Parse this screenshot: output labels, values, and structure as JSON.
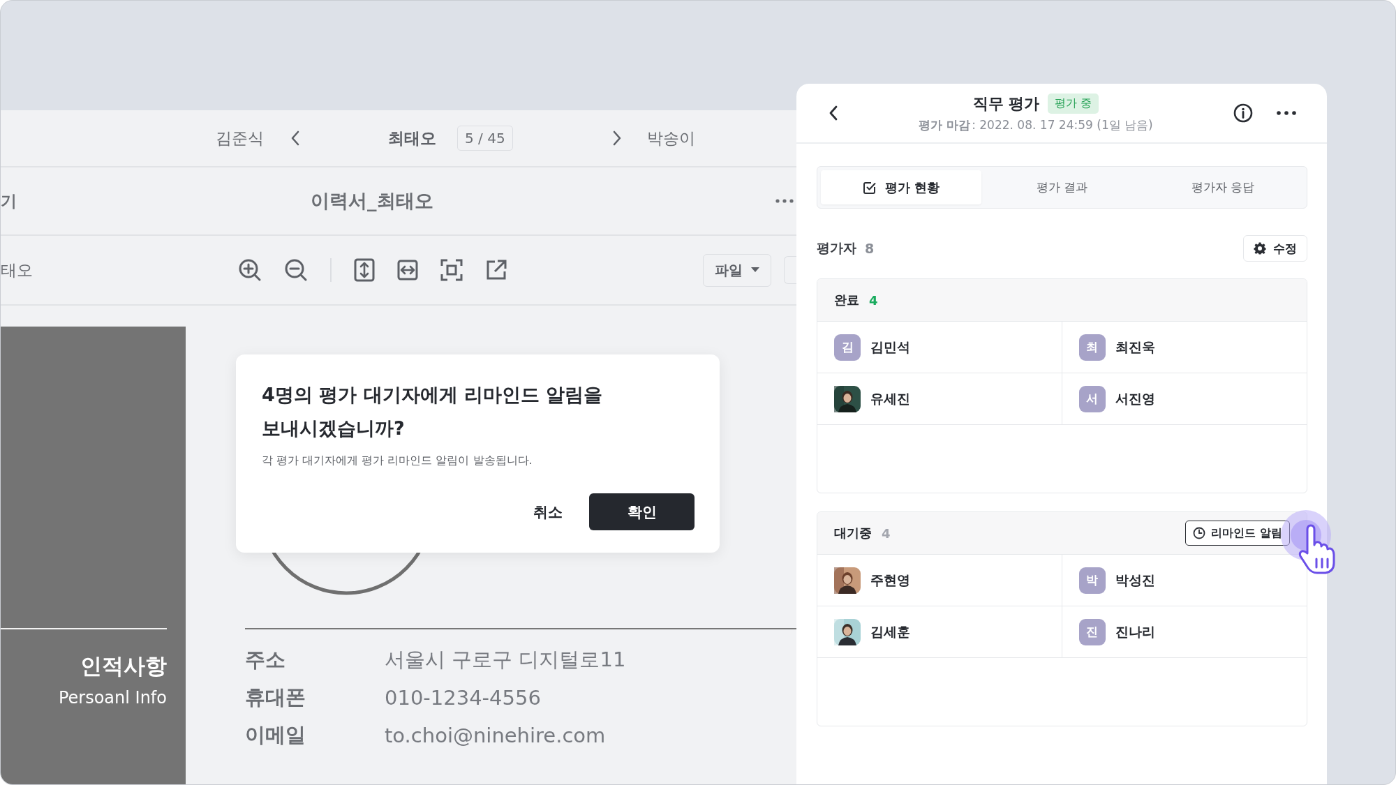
{
  "viewer": {
    "nav": {
      "prev_name": "김준식",
      "current_name": "최태오",
      "position": "5 / 45",
      "next_name": "박송이"
    },
    "title_bar": {
      "left_text": "기",
      "title": "이력서_최태오"
    },
    "toolbar": {
      "left_text": "태오",
      "file_menu": "파일"
    },
    "document": {
      "section_title": "인적사항",
      "section_subtitle": "Persoanl Info",
      "fields": [
        {
          "label": "주소",
          "value": "서울시 구로구 디지털로11"
        },
        {
          "label": "휴대폰",
          "value": "010-1234-4556"
        },
        {
          "label": "이메일",
          "value": "to.choi@ninehire.com"
        }
      ]
    }
  },
  "dialog": {
    "title_lines": [
      "4명의 평가 대기자에게 리마인드 알림을",
      "보내시겠습니까?"
    ],
    "message": "각 평가 대기자에게 평가 리마인드 알림이 발송됩니다.",
    "cancel": "취소",
    "confirm": "확인"
  },
  "panel": {
    "title": "직무 평가",
    "status_badge": "평가 중",
    "deadline_label": "평가 마감",
    "deadline_value": ": 2022. 08. 17 24:59 (1일 남음)",
    "tabs": [
      {
        "label": "평가 현황",
        "selected": true
      },
      {
        "label": "평가 결과",
        "selected": false
      },
      {
        "label": "평가자 응답",
        "selected": false
      }
    ],
    "evaluators": {
      "label": "평가자",
      "count": "8",
      "edit_button": "수정"
    },
    "groups": [
      {
        "label": "완료",
        "count": "4",
        "color": "#1aab5e",
        "members": [
          {
            "name": "김민석",
            "avatar": {
              "kind": "initial",
              "text": "김"
            }
          },
          {
            "name": "최진욱",
            "avatar": {
              "kind": "initial",
              "text": "최"
            }
          },
          {
            "name": "유세진"
          },
          {
            "name": "서진영",
            "avatar": {
              "kind": "initial",
              "text": "서"
            }
          }
        ]
      },
      {
        "label": "대기중",
        "count": "4",
        "color": "#a3a6ae",
        "action_button": "리마인드 알림",
        "members": [
          {
            "name": "주현영"
          },
          {
            "name": "박성진",
            "avatar": {
              "kind": "initial",
              "text": "박"
            }
          },
          {
            "name": "김세훈"
          },
          {
            "name": "진나리",
            "avatar": {
              "kind": "initial",
              "text": "진"
            }
          }
        ]
      }
    ]
  }
}
